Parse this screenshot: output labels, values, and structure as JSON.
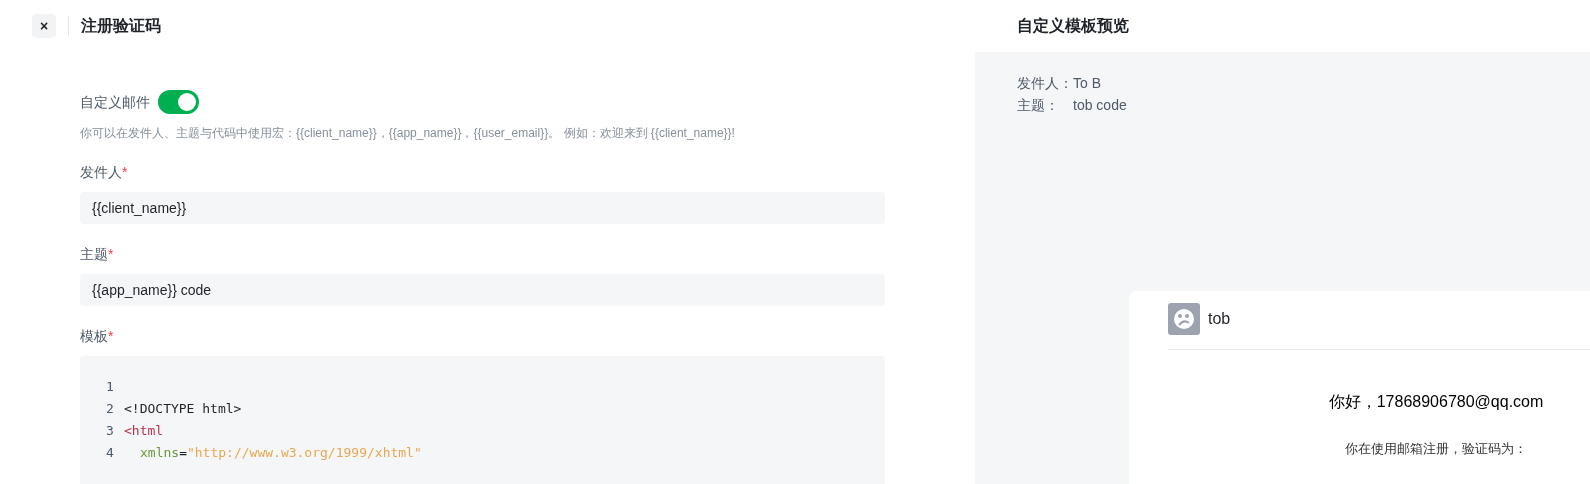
{
  "header": {
    "close_label": "×",
    "title": "注册验证码"
  },
  "custom_email": {
    "label": "自定义邮件",
    "on": true
  },
  "hint": "你可以在发件人、主题与代码中使用宏：{{client_name}}，{{app_name}}，{{user_email}}。 例如：欢迎来到 {{client_name}}!",
  "fields": [
    {
      "label": "发件人",
      "required": "*",
      "value": "{{client_name}}"
    },
    {
      "label": "主题",
      "required": "*",
      "value": "{{app_name}} code"
    }
  ],
  "template": {
    "label": "模板",
    "required": "*",
    "lines": [
      {
        "number": "1"
      },
      {
        "number": "2",
        "tokens": [
          {
            "kind": "plain",
            "text": "<!DOCTYPE html>"
          }
        ]
      },
      {
        "number": "3",
        "tokens": [
          {
            "kind": "tag",
            "text": "<html"
          }
        ]
      },
      {
        "number": "4",
        "indented": true,
        "tokens": [
          {
            "kind": "attr",
            "text": "xmlns"
          },
          {
            "kind": "plain",
            "text": "="
          },
          {
            "kind": "string",
            "text": "\"http://www.w3.org/1999/xhtml\""
          }
        ]
      }
    ]
  },
  "preview": {
    "title": "自定义模板预览",
    "meta": [
      {
        "label": "发件人：",
        "value": "To B"
      },
      {
        "label": "主题：",
        "value": "tob code"
      }
    ],
    "email": {
      "sender": "tob",
      "greeting": "你好，17868906780@qq.com",
      "body": "你在使用邮箱注册，验证码为："
    }
  }
}
